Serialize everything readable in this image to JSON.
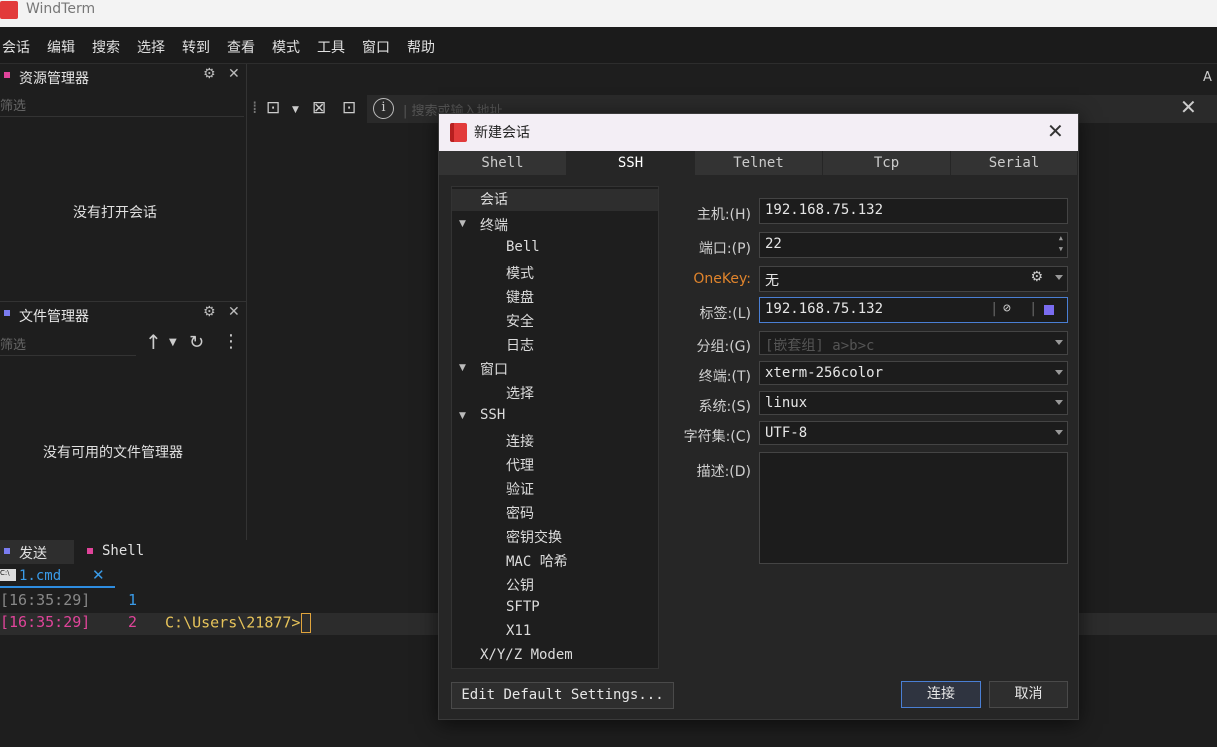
{
  "window": {
    "title": "WindTerm"
  },
  "menu": [
    "会话",
    "编辑",
    "搜索",
    "选择",
    "转到",
    "查看",
    "模式",
    "工具",
    "窗口",
    "帮助"
  ],
  "resource_panel": {
    "title": "资源管理器",
    "filter_placeholder": "筛选",
    "empty_text": "没有打开会话"
  },
  "file_panel": {
    "title": "文件管理器",
    "filter_placeholder": "筛选",
    "empty_text": "没有可用的文件管理器"
  },
  "address_bar": {
    "placeholder": "| 搜索或输入地址",
    "right_letter": "A"
  },
  "bottom_tabs": {
    "send": "发送",
    "shell": "Shell",
    "file_tab": "1.cmd"
  },
  "terminal": [
    {
      "time": "[16:35:29]",
      "num": "1",
      "text": ""
    },
    {
      "time": "[16:35:29]",
      "num": "2",
      "text": "C:\\Users\\21877>"
    }
  ],
  "dialog": {
    "title": "新建会话",
    "tabs": [
      "Shell",
      "SSH",
      "Telnet",
      "Tcp",
      "Serial"
    ],
    "active_tab": "SSH",
    "tree": [
      {
        "label": "会话",
        "level": 0,
        "arrow": false,
        "selected": true
      },
      {
        "label": "终端",
        "level": 0,
        "arrow": true
      },
      {
        "label": "Bell",
        "level": 1
      },
      {
        "label": "模式",
        "level": 1
      },
      {
        "label": "键盘",
        "level": 1
      },
      {
        "label": "安全",
        "level": 1
      },
      {
        "label": "日志",
        "level": 1
      },
      {
        "label": "窗口",
        "level": 0,
        "arrow": true
      },
      {
        "label": "选择",
        "level": 1
      },
      {
        "label": "SSH",
        "level": 0,
        "arrow": true
      },
      {
        "label": "连接",
        "level": 1
      },
      {
        "label": "代理",
        "level": 1
      },
      {
        "label": "验证",
        "level": 1
      },
      {
        "label": "密码",
        "level": 1
      },
      {
        "label": "密钥交换",
        "level": 1
      },
      {
        "label": "MAC 哈希",
        "level": 1
      },
      {
        "label": "公钥",
        "level": 1
      },
      {
        "label": "SFTP",
        "level": 1
      },
      {
        "label": "X11",
        "level": 1
      },
      {
        "label": "X/Y/Z Modem",
        "level": 0,
        "arrow": false
      }
    ],
    "fields": {
      "host": {
        "label": "主机:(H)",
        "value": "192.168.75.132"
      },
      "port": {
        "label": "端口:(P)",
        "value": "22"
      },
      "onekey": {
        "label": "OneKey:",
        "value": "无"
      },
      "tag": {
        "label": "标签:(L)",
        "value": "192.168.75.132"
      },
      "group": {
        "label": "分组:(G)",
        "placeholder": "[嵌套组] a>b>c"
      },
      "terminal": {
        "label": "终端:(T)",
        "value": "xterm-256color"
      },
      "system": {
        "label": "系统:(S)",
        "value": "linux"
      },
      "charset": {
        "label": "字符集:(C)",
        "value": "UTF-8"
      },
      "description": {
        "label": "描述:(D)",
        "value": ""
      }
    },
    "buttons": {
      "edit_defaults": "Edit Default Settings...",
      "connect": "连接",
      "cancel": "取消"
    }
  },
  "colors": {
    "accent": "#4a7fd4",
    "onekey": "#e0842c",
    "terminal_time_active": "#e0449a",
    "terminal_prompt": "#e6c35a"
  }
}
